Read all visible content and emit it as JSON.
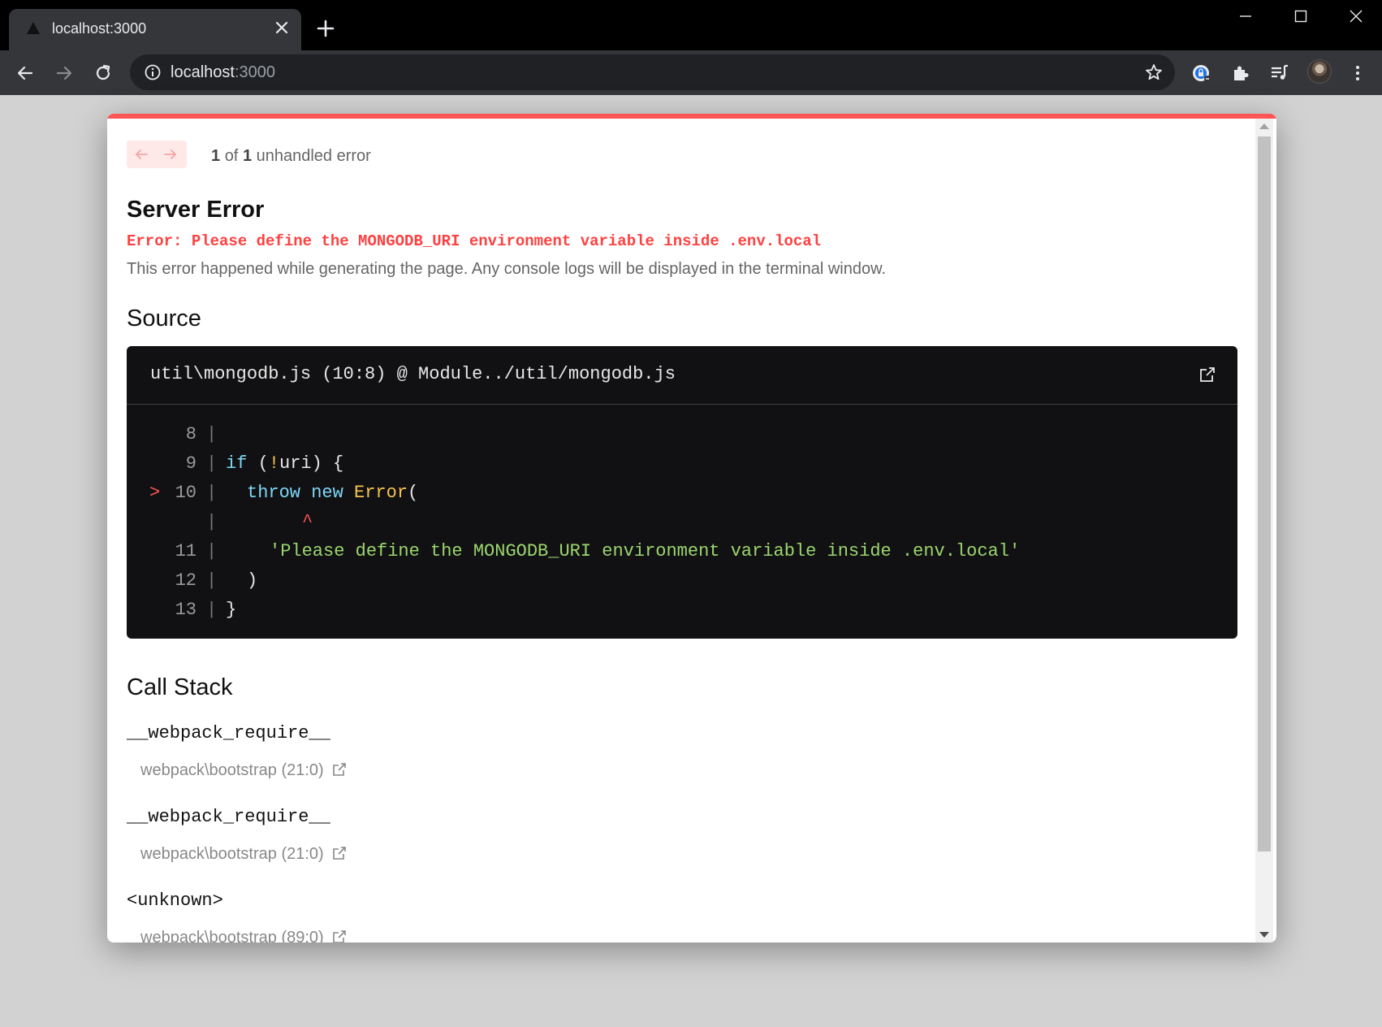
{
  "browser": {
    "tab_title": "localhost:3000",
    "url_host": "localhost",
    "url_port": ":3000"
  },
  "overlay": {
    "pager": {
      "current": "1",
      "of": "of",
      "total": "1",
      "suffix": "unhandled error"
    },
    "heading": "Server Error",
    "error_message": "Error: Please define the MONGODB_URI environment variable inside .env.local",
    "description": "This error happened while generating the page. Any console logs will be displayed in the terminal window.",
    "source_heading": "Source",
    "source_file": "util\\mongodb.js (10:8) @ Module../util/mongodb.js",
    "code": {
      "l8": "8",
      "l9": "9",
      "l10": "10",
      "l11": "11",
      "l12": "12",
      "l13": "13",
      "marker": ">",
      "pipe": "|",
      "if_kw": "if",
      "if_open": " (",
      "bang": "!",
      "if_rest": "uri) {",
      "throw_kw": "throw",
      "new_kw": "new",
      "error_fn": "Error",
      "paren_open": "(",
      "caret": "^",
      "string": "'Please define the MONGODB_URI environment variable inside .env.local'",
      "paren_close": ")",
      "brace_close": "}"
    },
    "call_stack_heading": "Call Stack",
    "call_stack": [
      {
        "fn": "__webpack_require__",
        "loc": "webpack\\bootstrap (21:0)"
      },
      {
        "fn": "__webpack_require__",
        "loc": "webpack\\bootstrap (21:0)"
      },
      {
        "fn": "<unknown>",
        "loc": "webpack\\bootstrap (89:0)"
      }
    ]
  },
  "colors": {
    "accent_red": "#ff5555",
    "code_bg": "#111113",
    "keyword": "#7ed8f7",
    "function": "#f6c44f",
    "string": "#9cd66e"
  },
  "icons": [
    "triangle-favicon-icon",
    "close-icon",
    "plus-icon",
    "minimize-icon",
    "maximize-icon",
    "window-close-icon",
    "back-arrow-icon",
    "forward-arrow-icon",
    "reload-icon",
    "info-icon",
    "star-icon",
    "password-manager-icon",
    "puzzle-extensions-icon",
    "media-queue-icon",
    "kebab-menu-icon",
    "external-link-icon"
  ]
}
